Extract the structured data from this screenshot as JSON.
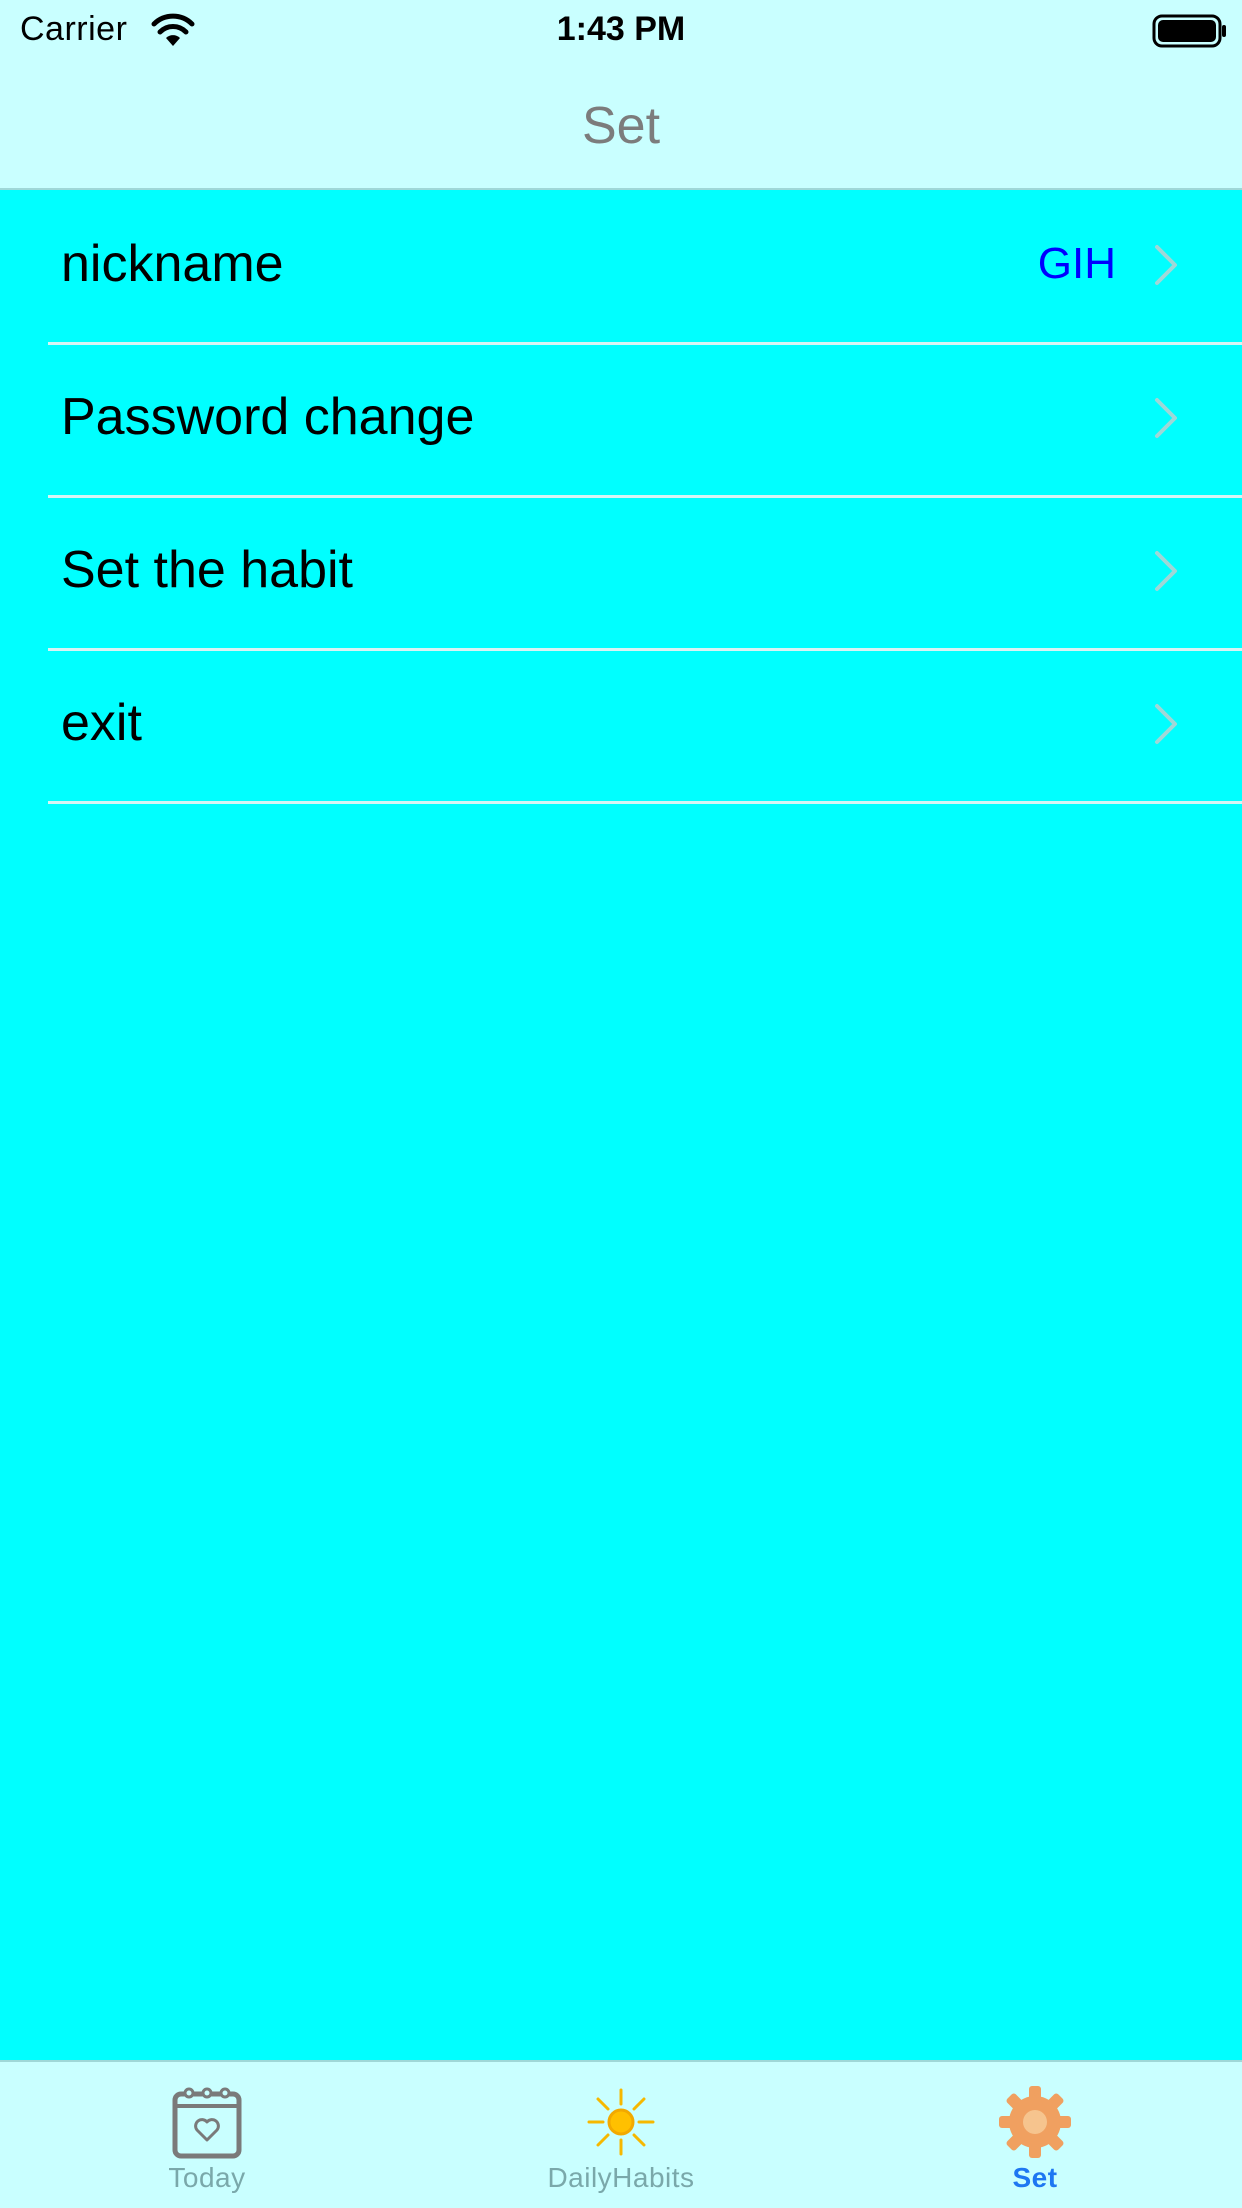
{
  "status_bar": {
    "carrier": "Carrier",
    "time": "1:43 PM"
  },
  "nav": {
    "title": "Set"
  },
  "settings": {
    "rows": [
      {
        "label": "nickname",
        "detail": "GIH"
      },
      {
        "label": "Password change",
        "detail": ""
      },
      {
        "label": "Set the habit",
        "detail": ""
      },
      {
        "label": "exit",
        "detail": ""
      }
    ]
  },
  "tab_bar": {
    "tabs": [
      {
        "label": "Today",
        "icon": "calendar-heart-icon",
        "active": false
      },
      {
        "label": "DailyHabits",
        "icon": "sun-icon",
        "active": false
      },
      {
        "label": "Set",
        "icon": "gear-icon",
        "active": true
      }
    ]
  },
  "colors": {
    "background": "#00FFFF",
    "bars": "#C9FFFF",
    "detail_text": "#0000FF",
    "active_tab": "#1E77F2",
    "inactive_tab": "#7AA8AA"
  }
}
